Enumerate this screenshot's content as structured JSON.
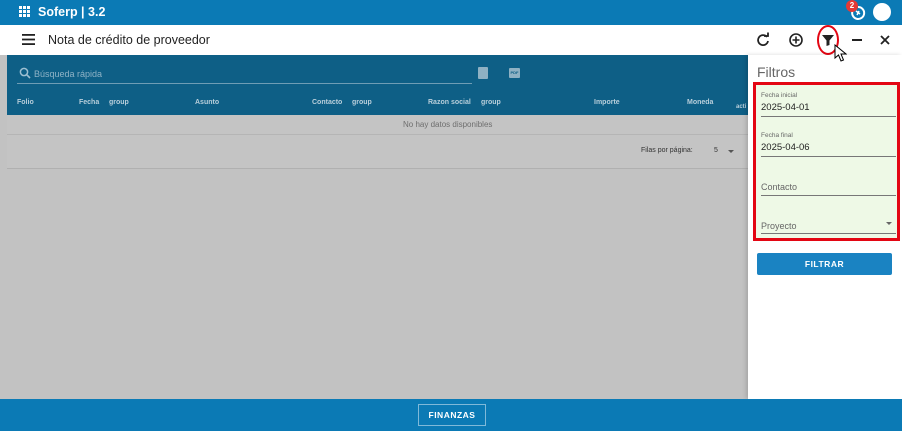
{
  "app": {
    "brand": "Soferp | 3.2",
    "notifications_count": "2"
  },
  "toolbar": {
    "title": "Nota de crédito de proveedor"
  },
  "table": {
    "search_placeholder": "Búsqueda rápida",
    "pdf_label": "PDF",
    "columns": [
      "Folio",
      "Fecha",
      "group",
      "Asunto",
      "Contacto",
      "group",
      "Razon social",
      "group",
      "Importe",
      "Moneda",
      "acti"
    ],
    "empty_message": "No hay datos disponibles",
    "rows_per_page_label": "Filas por página:",
    "rows_per_page_value": "5"
  },
  "filters": {
    "title": "Filtros",
    "fecha_inicial_label": "Fecha inicial",
    "fecha_inicial_value": "2025-04-01",
    "fecha_final_label": "Fecha final",
    "fecha_final_value": "2025-04-06",
    "contacto_placeholder": "Contacto",
    "proyecto_placeholder": "Proyecto",
    "apply_label": "FILTRAR"
  },
  "bottom": {
    "module_label": "FINANZAS"
  },
  "colors": {
    "primary": "#0b7ab5",
    "header_dark": "#0e5f86",
    "highlight": "#e30613",
    "filter_bg": "#eef9e6"
  }
}
